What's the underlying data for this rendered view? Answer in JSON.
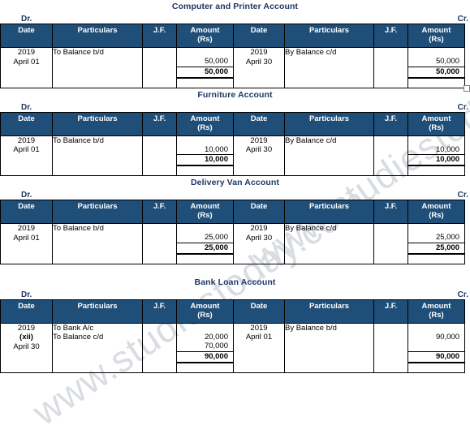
{
  "watermark": {
    "line1": "www.studiestoday.com",
    "line2": "www.studiestoday.com"
  },
  "columns": {
    "date": "Date",
    "particulars": "Particulars",
    "jf": "J.F.",
    "amount_main": "Amount",
    "amount_sub": "(Rs)"
  },
  "side_labels": {
    "debit": "Dr.",
    "credit": "Cr."
  },
  "accounts": [
    {
      "title": "Computer and Printer  Account",
      "debit": {
        "date_lines": [
          "2019",
          "April 01"
        ],
        "particulars_lines": [
          "To Balance b/d"
        ],
        "jf": "",
        "amount_lines": [
          "50,000"
        ],
        "total": "50,000"
      },
      "credit": {
        "date_lines": [
          "2019",
          "April 30"
        ],
        "particulars_lines": [
          "By Balance c/d"
        ],
        "jf": "",
        "amount_lines": [
          "50,000"
        ],
        "total": "50,000"
      },
      "has_resize_handle": true
    },
    {
      "title": "Furniture Account",
      "debit": {
        "date_lines": [
          "2019",
          "April 01"
        ],
        "particulars_lines": [
          "To Balance b/d"
        ],
        "jf": "",
        "amount_lines": [
          "10,000"
        ],
        "total": "10,000"
      },
      "credit": {
        "date_lines": [
          "2019",
          "April 30"
        ],
        "particulars_lines": [
          "By Balance c/d"
        ],
        "jf": "",
        "amount_lines": [
          "10,000"
        ],
        "total": "10,000"
      },
      "has_resize_handle": false
    },
    {
      "title": "Delivery Van Account",
      "debit": {
        "date_lines": [
          "2019",
          "April 01"
        ],
        "particulars_lines": [
          "To Balance b/d"
        ],
        "jf": "",
        "amount_lines": [
          "25,000"
        ],
        "total": "25,000"
      },
      "credit": {
        "date_lines": [
          "2019",
          "April 30"
        ],
        "particulars_lines": [
          "By Balance c/d"
        ],
        "jf": "",
        "amount_lines": [
          "25,000"
        ],
        "total": "25,000"
      },
      "has_resize_handle": false
    },
    {
      "title": "Bank Loan Account",
      "debit": {
        "date_lines": [
          "2019",
          "(xii)",
          "April 30"
        ],
        "date_bold_index": 1,
        "particulars_lines": [
          "To Bank A/c",
          "To Balance c/d"
        ],
        "jf": "",
        "amount_lines": [
          "20,000",
          "70,000"
        ],
        "total": "90,000"
      },
      "credit": {
        "date_lines": [
          "2019",
          "April 01"
        ],
        "particulars_lines": [
          "By Balance b/d"
        ],
        "jf": "",
        "amount_lines": [
          "90,000"
        ],
        "total": "90,000"
      },
      "has_resize_handle": false
    }
  ],
  "colors": {
    "header_bg": "#1F4E79",
    "title_text": "#1F3864",
    "border": "#000000",
    "watermark": "#D9DDE2"
  }
}
